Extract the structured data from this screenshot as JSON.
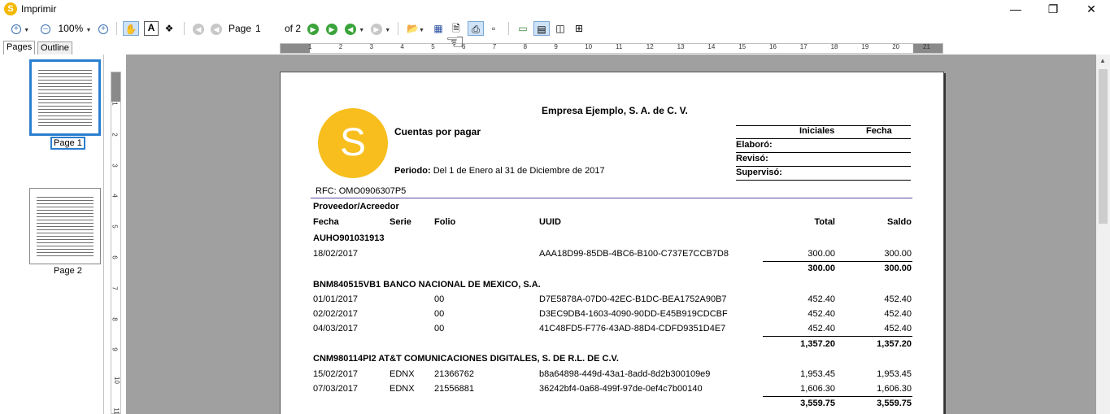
{
  "window": {
    "title": "Imprimir",
    "app_icon_letter": "S"
  },
  "toolbar": {
    "zoom": "100%",
    "page_label": "Page",
    "page_value": "1",
    "page_of": "of 2"
  },
  "tabs": [
    "Pages",
    "Outline"
  ],
  "ruler": {
    "numbers": [
      "1",
      "2",
      "3",
      "4",
      "5",
      "6",
      "7",
      "8",
      "9",
      "10",
      "11",
      "12",
      "13",
      "14",
      "15",
      "16",
      "17",
      "18",
      "19",
      "20",
      "21"
    ]
  },
  "vruler": {
    "numbers": [
      "1",
      "2",
      "3",
      "4",
      "5",
      "6",
      "7",
      "8",
      "9",
      "10",
      "11"
    ]
  },
  "thumbnails": [
    {
      "label": "Page 1",
      "selected": true
    },
    {
      "label": "Page 2",
      "selected": false
    }
  ],
  "report": {
    "logo_letter": "S",
    "company": "Empresa Ejemplo, S. A. de C. V.",
    "report_title": "Cuentas por pagar",
    "period_label": "Periodo:",
    "period_value": "Del 1 de Enero al 31 de Diciembre de 2017",
    "rfc": "RFC: OMO0906307P5",
    "sign_headers": {
      "initials": "Iniciales",
      "date": "Fecha"
    },
    "sign_rows": [
      "Elaboró:",
      "Revisó:",
      "Supervisó:"
    ],
    "section_title": "Proveedor/Acreedor",
    "columns": {
      "fecha": "Fecha",
      "serie": "Serie",
      "folio": "Folio",
      "uuid": "UUID",
      "total": "Total",
      "saldo": "Saldo"
    },
    "groups": [
      {
        "name": "AUHO901031913",
        "rows": [
          {
            "fecha": "18/02/2017",
            "serie": "",
            "folio": "",
            "uuid": "AAA18D99-85DB-4BC6-B100-C737E7CCB7D8",
            "total": "300.00",
            "saldo": "300.00"
          }
        ],
        "sum_total": "300.00",
        "sum_saldo": "300.00"
      },
      {
        "name": "BNM840515VB1 BANCO NACIONAL DE MEXICO, S.A.",
        "rows": [
          {
            "fecha": "01/01/2017",
            "serie": "",
            "folio": "00",
            "uuid": "D7E5878A-07D0-42EC-B1DC-BEA1752A90B7",
            "total": "452.40",
            "saldo": "452.40"
          },
          {
            "fecha": "02/02/2017",
            "serie": "",
            "folio": "00",
            "uuid": "D3EC9DB4-1603-4090-90DD-E45B919CDCBF",
            "total": "452.40",
            "saldo": "452.40"
          },
          {
            "fecha": "04/03/2017",
            "serie": "",
            "folio": "00",
            "uuid": "41C48FD5-F776-43AD-88D4-CDFD9351D4E7",
            "total": "452.40",
            "saldo": "452.40"
          }
        ],
        "sum_total": "1,357.20",
        "sum_saldo": "1,357.20"
      },
      {
        "name": "CNM980114PI2 AT&T COMUNICACIONES DIGITALES, S. DE R.L. DE C.V.",
        "rows": [
          {
            "fecha": "15/02/2017",
            "serie": "EDNX",
            "folio": "21366762",
            "uuid": "b8a64898-449d-43a1-8add-8d2b300109e9",
            "total": "1,953.45",
            "saldo": "1,953.45"
          },
          {
            "fecha": "07/03/2017",
            "serie": "EDNX",
            "folio": "21556881",
            "uuid": "36242bf4-0a68-499f-97de-0ef4c7b00140",
            "total": "1,606.30",
            "saldo": "1,606.30"
          }
        ],
        "sum_total": "3,559.75",
        "sum_saldo": "3,559.75"
      }
    ]
  }
}
